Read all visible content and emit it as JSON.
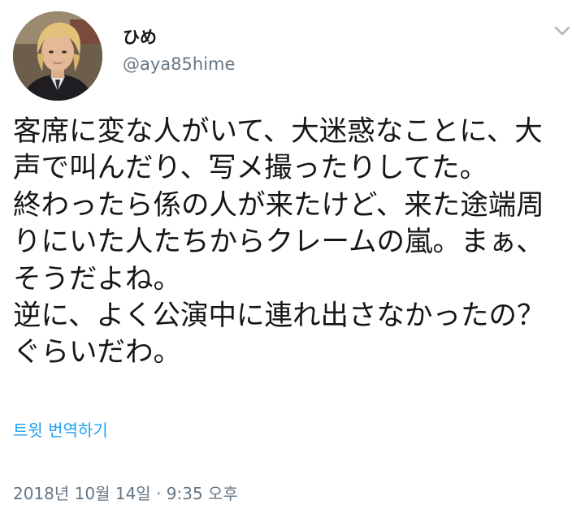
{
  "user": {
    "display_name": "ひめ",
    "handle": "@aya85hime",
    "avatar_icon": "profile-photo"
  },
  "menu": {
    "icon": "chevron-down-icon"
  },
  "tweet": {
    "lines": [
      "客席に変な人がいて、大迷惑なことに、大",
      "声で叫んだり、写メ撮ったりしてた。",
      "終わったら係の人が来たけど、来た途端周",
      "りにいた人たちからクレームの嵐。まぁ、",
      "そうだよね。",
      "逆に、よく公演中に連れ出さなかったの？",
      "ぐらいだわ。"
    ]
  },
  "translate": {
    "label": "트윗 번역하기"
  },
  "timestamp": {
    "text": "2018년 10월 14일 · 9:35 오후"
  },
  "colors": {
    "text": "#14171a",
    "secondary": "#657786",
    "link": "#1da1f2",
    "background": "#ffffff"
  }
}
